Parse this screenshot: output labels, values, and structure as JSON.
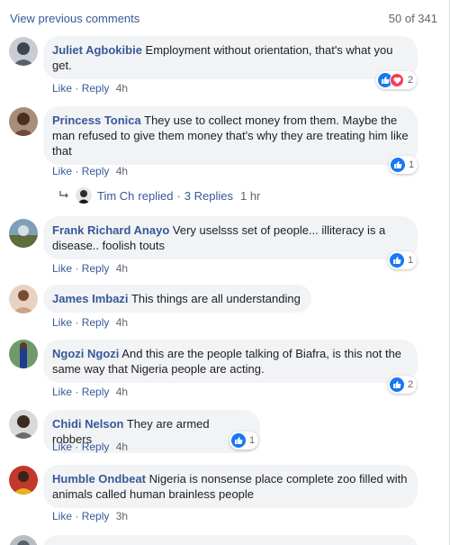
{
  "header": {
    "view_previous": "View previous comments",
    "count": "50 of 341"
  },
  "comments": [
    {
      "author": "Juliet Agbokibie",
      "text": "Employment without orientation, that's what you get.",
      "like": "Like",
      "sep": "·",
      "reply": "Reply",
      "time": "4h",
      "reactions": "2",
      "reaction_types": [
        "like-icon",
        "love-icon"
      ]
    },
    {
      "author": "Princess Tonica",
      "text": "They use to collect money from them. Maybe the man refused to give them money that's why they are treating him like that",
      "like": "Like",
      "sep": "·",
      "reply": "Reply",
      "time": "4h",
      "reactions": "1",
      "reaction_types": [
        "like-icon"
      ]
    },
    {
      "author": "Frank Richard Anayo",
      "text": "Very uselsss set of people... illiteracy is a disease.. foolish touts",
      "like": "Like",
      "sep": "·",
      "reply": "Reply",
      "time": "4h",
      "reactions": "1",
      "reaction_types": [
        "like-icon"
      ]
    },
    {
      "author": "James Imbazi",
      "text": "This things are all understanding",
      "like": "Like",
      "sep": "·",
      "reply": "Reply",
      "time": "4h"
    },
    {
      "author": "Ngozi Ngozi",
      "text": "And this are the people talking of Biafra, is this not the same way that Nigeria people are acting.",
      "like": "Like",
      "sep": "·",
      "reply": "Reply",
      "time": "4h",
      "reactions": "2",
      "reaction_types": [
        "like-icon"
      ]
    },
    {
      "author": "Chidi Nelson",
      "text": "They are armed robbers",
      "like": "Like",
      "sep": "·",
      "reply": "Reply",
      "time": "4h",
      "reactions": "1",
      "reaction_types": [
        "like-icon"
      ]
    },
    {
      "author": "Humble Ondbeat",
      "text": "Nigeria is nonsense place complete zoo filled with animals called human brainless people",
      "like": "Like",
      "sep": "·",
      "reply": "Reply",
      "time": "3h"
    }
  ],
  "reply_thread": {
    "author": "Tim Ch",
    "replied": "replied",
    "sep": "·",
    "count_label": "3 Replies",
    "time": "1 hr"
  },
  "colors": {
    "link": "#385898",
    "bubble": "#f2f3f5",
    "like_blue": "#1877f2",
    "love_red": "#f33e58"
  }
}
